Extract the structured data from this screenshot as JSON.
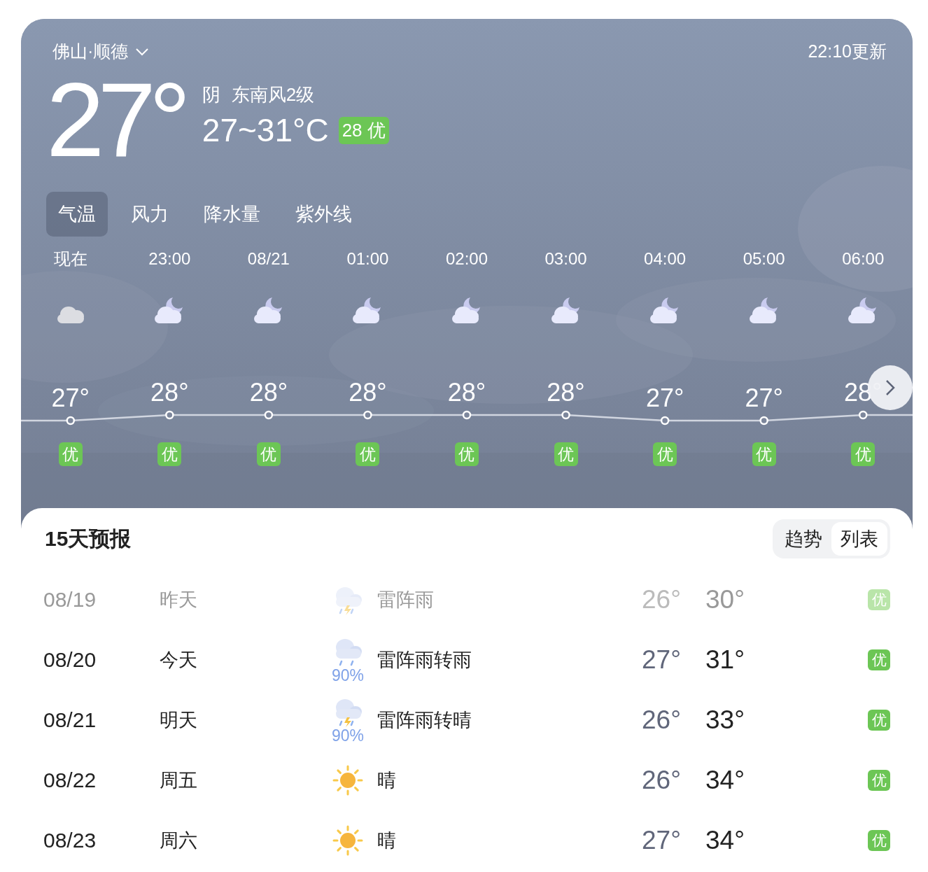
{
  "location": {
    "name": "佛山·顺德",
    "update_time": "22:10更新"
  },
  "current": {
    "temperature": "27°",
    "condition": "阴",
    "wind": "东南风2级",
    "range": "27~31°C",
    "aqi": "28 优"
  },
  "tabs": [
    {
      "label": "气温",
      "selected": true
    },
    {
      "label": "风力",
      "selected": false
    },
    {
      "label": "降水量",
      "selected": false
    },
    {
      "label": "紫外线",
      "selected": false
    }
  ],
  "hourly": [
    {
      "time": "现在",
      "kind": "cloudy",
      "temperature": "27°",
      "aqi": "优"
    },
    {
      "time": "23:00",
      "kind": "cloudy-night",
      "temperature": "28°",
      "aqi": "优"
    },
    {
      "time": "08/21",
      "kind": "cloudy-night",
      "temperature": "28°",
      "aqi": "优"
    },
    {
      "time": "01:00",
      "kind": "cloudy-night",
      "temperature": "28°",
      "aqi": "优"
    },
    {
      "time": "02:00",
      "kind": "cloudy-night",
      "temperature": "28°",
      "aqi": "优"
    },
    {
      "time": "03:00",
      "kind": "cloudy-night",
      "temperature": "28°",
      "aqi": "优"
    },
    {
      "time": "04:00",
      "kind": "cloudy-night",
      "temperature": "27°",
      "aqi": "优"
    },
    {
      "time": "05:00",
      "kind": "cloudy-night",
      "temperature": "27°",
      "aqi": "优"
    },
    {
      "time": "06:00",
      "kind": "cloudy-night",
      "temperature": "28°",
      "aqi": "优"
    }
  ],
  "forecast": {
    "title": "15天预报",
    "views": [
      {
        "label": "趋势",
        "selected": false
      },
      {
        "label": "列表",
        "selected": true
      }
    ],
    "days": [
      {
        "date": "08/19",
        "day": "昨天",
        "kind": "thunderstorm",
        "condition": "雷阵雨",
        "low": "26°",
        "high": "30°",
        "aqi": "优",
        "past": true
      },
      {
        "date": "08/20",
        "day": "今天",
        "kind": "rain",
        "precipitation": "90%",
        "condition": "雷阵雨转雨",
        "low": "27°",
        "high": "31°",
        "aqi": "优",
        "past": false
      },
      {
        "date": "08/21",
        "day": "明天",
        "kind": "thunderstorm",
        "precipitation": "90%",
        "condition": "雷阵雨转晴",
        "low": "26°",
        "high": "33°",
        "aqi": "优",
        "past": false
      },
      {
        "date": "08/22",
        "day": "周五",
        "kind": "sunny",
        "condition": "晴",
        "low": "26°",
        "high": "34°",
        "aqi": "优",
        "past": false
      },
      {
        "date": "08/23",
        "day": "周六",
        "kind": "sunny",
        "condition": "晴",
        "low": "27°",
        "high": "34°",
        "aqi": "优",
        "past": false
      }
    ]
  }
}
